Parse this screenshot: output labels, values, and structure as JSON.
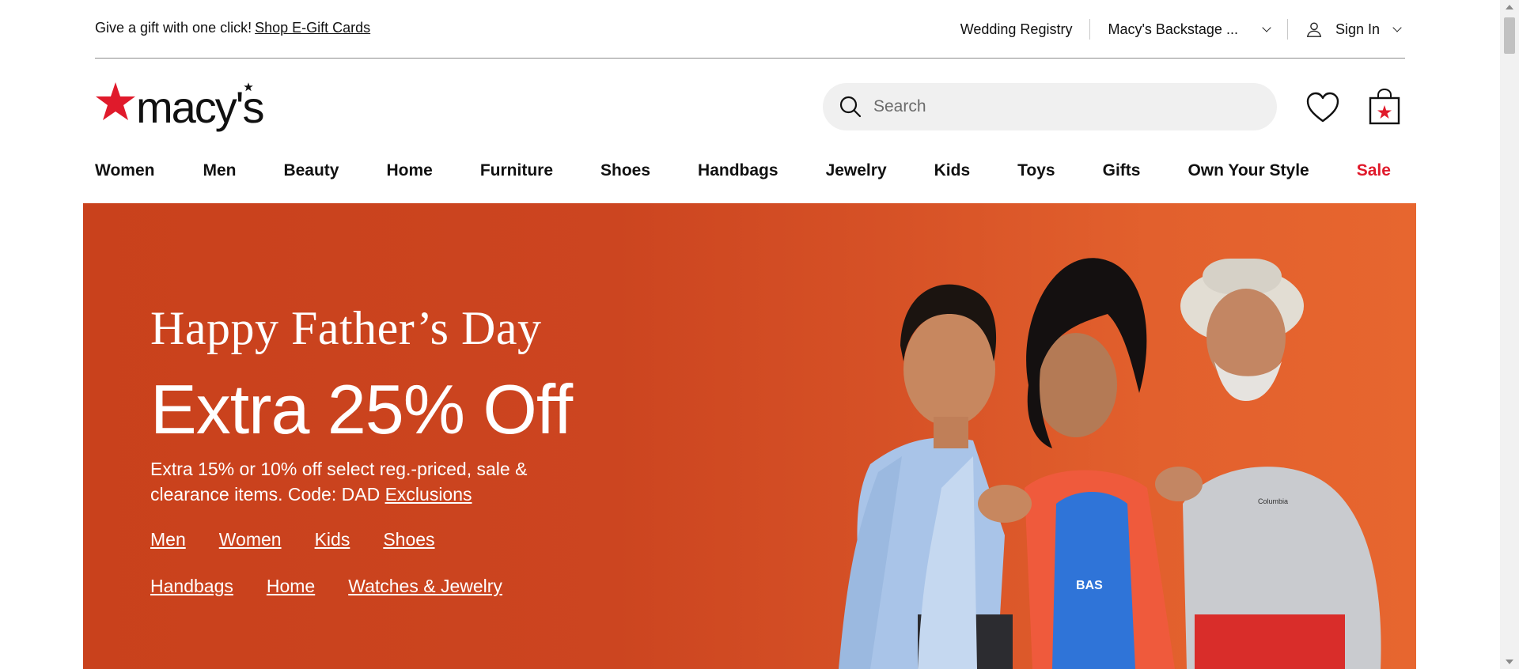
{
  "utility": {
    "promo_text": "Give a gift with one click!",
    "promo_link": "Shop E-Gift Cards",
    "wedding_registry": "Wedding Registry",
    "backstage": "Macy's Backstage ...",
    "sign_in": "Sign In"
  },
  "header": {
    "logo_text": "macy's",
    "search_placeholder": "Search",
    "icons": [
      "search-icon",
      "heart-icon",
      "shopping-bag-icon",
      "user-icon",
      "chevron-down-icon"
    ]
  },
  "nav": {
    "items": [
      "Women",
      "Men",
      "Beauty",
      "Home",
      "Furniture",
      "Shoes",
      "Handbags",
      "Jewelry",
      "Kids",
      "Toys",
      "Gifts",
      "Own Your Style",
      "Sale"
    ]
  },
  "hero": {
    "title": "Happy Father’s Day",
    "headline": "Extra 25% Off",
    "description": "Extra 15% or 10% off select reg.-priced, sale & clearance items. Code: DAD",
    "exclusions": "Exclusions",
    "links_row1": [
      "Men",
      "Women",
      "Kids",
      "Shoes"
    ],
    "links_row2": [
      "Handbags",
      "Home",
      "Watches & Jewelry"
    ],
    "shirt_print": "BAS",
    "polo_logo": "Columbia"
  },
  "colors": {
    "brand_red": "#e01a2b",
    "hero_bg": "#cc4520",
    "search_bg": "#f0f0f0"
  }
}
